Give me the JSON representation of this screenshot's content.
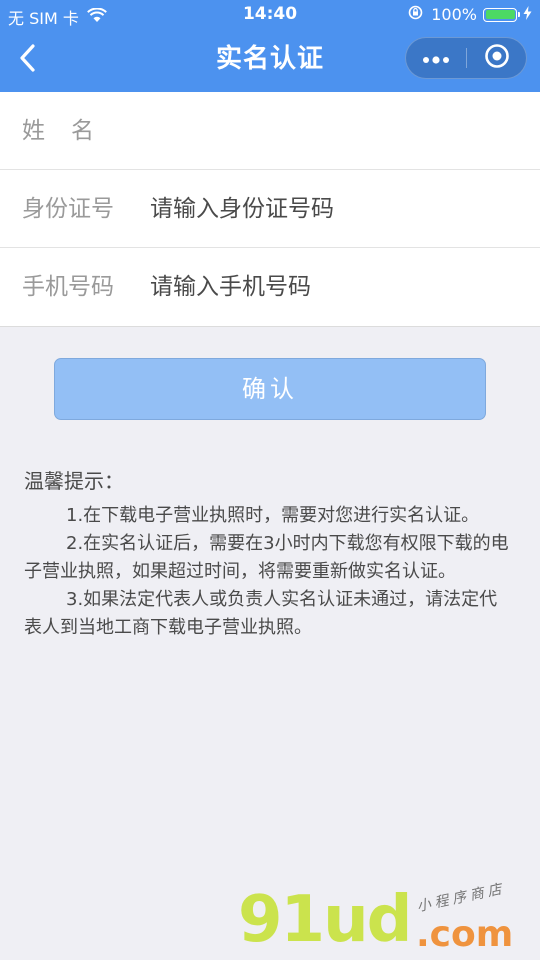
{
  "status_bar": {
    "carrier": "无 SIM 卡",
    "time": "14:40",
    "battery_percent": "100%"
  },
  "nav": {
    "title": "实名认证"
  },
  "form": {
    "name_label": "姓名",
    "name_placeholder": "",
    "id_label": "身份证号",
    "id_placeholder": "请输入身份证号码",
    "phone_label": "手机号码",
    "phone_placeholder": "请输入手机号码"
  },
  "confirm_label": "确认",
  "tips": {
    "title": "温馨提示：",
    "items": [
      "1.在下载电子营业执照时，需要对您进行实名认证。",
      "2.在实名认证后，需要在3小时内下载您有权限下载的电子营业执照，如果超过时间，将需要重新做实名认证。",
      "3.如果法定代表人或负责人实名认证未通过，请法定代表人到当地工商下载电子营业执照。"
    ]
  },
  "watermark": {
    "logo": "91ud",
    "domain": ".com",
    "subtitle": "小程序商店"
  },
  "colors": {
    "primary": "#4c92ef",
    "capsule": "#3b77c7",
    "button_disabled": "#93bff5",
    "background": "#efeff4",
    "battery": "#4cd964"
  },
  "icons": [
    "wifi-icon",
    "orientation-lock-icon",
    "battery-icon",
    "charging-icon",
    "back-arrow-icon",
    "more-dots-icon",
    "close-target-icon"
  ]
}
